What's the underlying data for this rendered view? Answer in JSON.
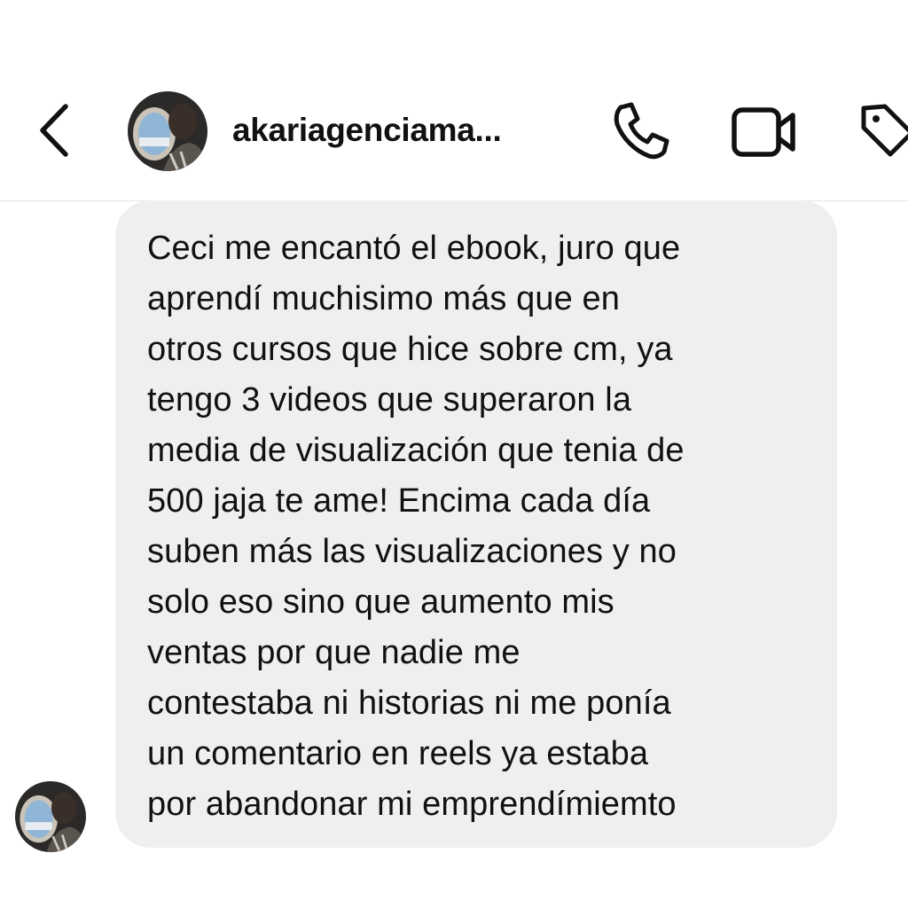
{
  "header": {
    "username": "akariagenciama...",
    "icons": {
      "back": "chevron-left-icon",
      "call": "phone-icon",
      "video": "video-camera-icon",
      "tag": "tag-icon"
    }
  },
  "message": {
    "lines": [
      "Ceci me encantó el ebook, juro que",
      "aprendí muchisimo más que en",
      "otros cursos que hice sobre cm, ya",
      "tengo 3 videos que superaron la",
      "media de visualización que tenia de",
      "500 jaja te ame! Encima cada día",
      "suben más las visualizaciones y no",
      "solo eso sino que aumento mis",
      "ventas por que nadie me",
      "contestaba ni historias ni me ponía",
      "un comentario en reels ya estaba",
      "por abandonar mi emprendímiemto"
    ]
  },
  "colors": {
    "bubble": "#efefef",
    "text": "#111111",
    "divider": "#e6e6e6"
  }
}
